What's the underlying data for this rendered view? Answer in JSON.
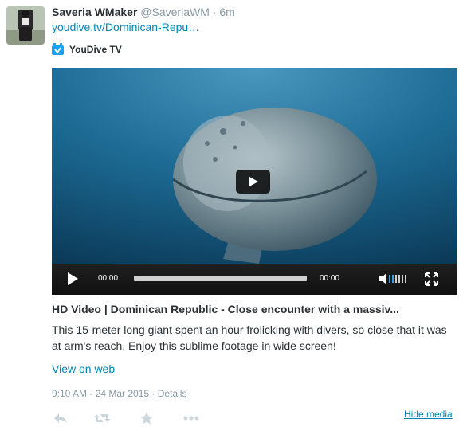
{
  "tweet": {
    "author_name": "Saveria WMaker",
    "author_handle": "@SaveriaWM",
    "separator": "·",
    "time_ago": "6m",
    "link_text": "youdive.tv/Dominican-Repu…"
  },
  "card": {
    "source_name": "YouDive TV",
    "source_icon": "youdive-logo-icon",
    "title": "HD Video | Dominican Republic - Close encounter with a massiv...",
    "description": "This 15-meter long giant spent an hour frolicking with divers, so close that it was at arm's reach. Enjoy this sublime footage in wide screen!",
    "view_on_web": "View on web"
  },
  "player": {
    "current_time": "00:00",
    "duration": "00:00",
    "progress": 0,
    "icons": {
      "big_play": "play-icon",
      "play": "play-icon",
      "volume": "volume-icon",
      "fullscreen": "fullscreen-icon"
    }
  },
  "meta": {
    "timestamp": "9:10 AM - 24 Mar 2015",
    "separator": "·",
    "details": "Details"
  },
  "actions": [
    {
      "name": "reply",
      "icon": "reply-icon"
    },
    {
      "name": "retweet",
      "icon": "retweet-icon"
    },
    {
      "name": "favorite",
      "icon": "star-icon"
    },
    {
      "name": "more",
      "icon": "more-icon"
    }
  ],
  "hide_media": "Hide media",
  "colors": {
    "link": "#0084b4",
    "muted": "#8899a6",
    "text": "#292f33",
    "player_bar": "#151515",
    "source_icon": "#1da1f2"
  }
}
